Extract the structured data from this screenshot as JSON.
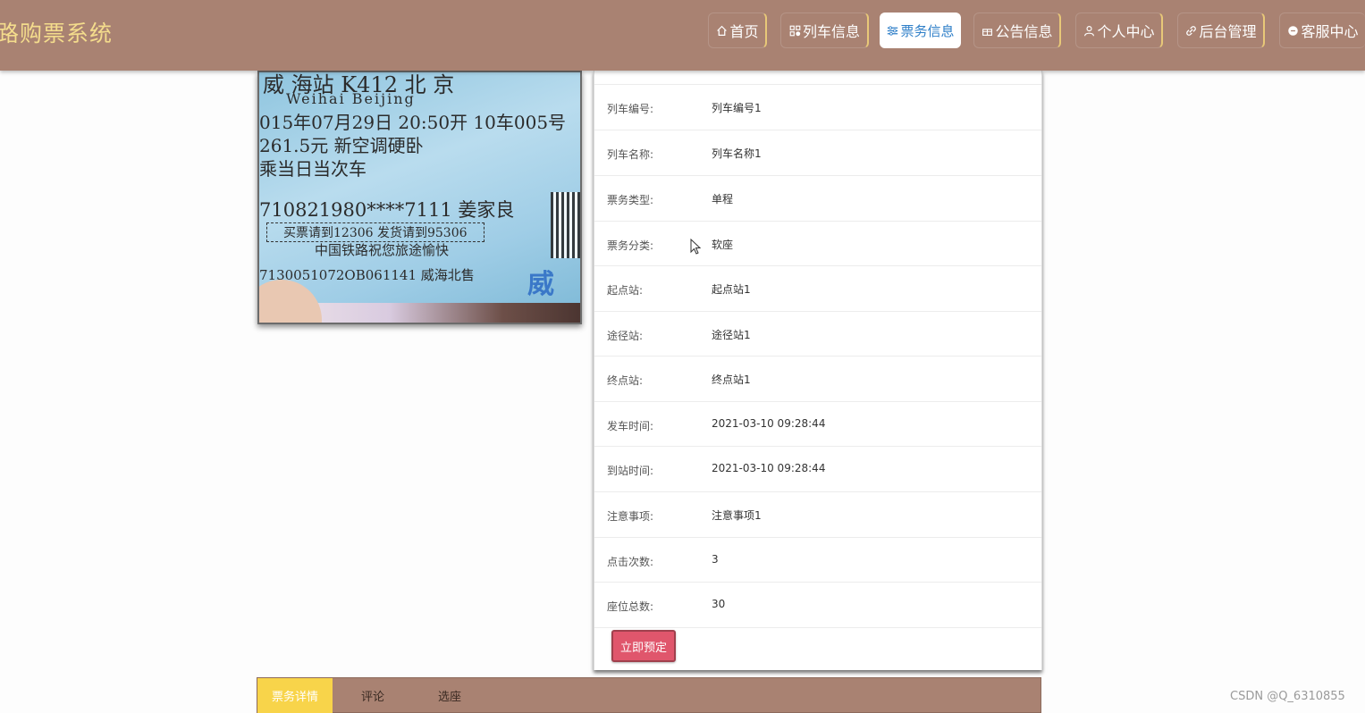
{
  "site": {
    "title": "铁路购票系统",
    "title_visible": "路购票系统"
  },
  "nav": {
    "items": [
      {
        "label": "首页",
        "icon": "home-icon"
      },
      {
        "label": "列车信息",
        "icon": "grid-icon"
      },
      {
        "label": "票务信息",
        "icon": "sliders-icon",
        "active": true
      },
      {
        "label": "公告信息",
        "icon": "gift-icon"
      },
      {
        "label": "个人中心",
        "icon": "user-icon"
      },
      {
        "label": "后台管理",
        "icon": "link-icon"
      },
      {
        "label": "客服中心",
        "icon": "chat-icon"
      }
    ]
  },
  "ticket_image": {
    "lines": [
      "威 海站  K412  北 京",
      "Weihai    Beijing",
      "015年07月29日 20:50开   10车005号",
      "261.5元   新空调硬卧",
      "乘当日当次车",
      "710821980****7111 姜家良",
      "买票请到12306 发货请到95306",
      "中国铁路祝您旅途愉快",
      "7130051072OB061141  威海北售",
      "威海"
    ]
  },
  "detail": {
    "rows": [
      {
        "label": "列车编号:",
        "value": "列车编号1"
      },
      {
        "label": "列车名称:",
        "value": "列车名称1"
      },
      {
        "label": "票务类型:",
        "value": "单程"
      },
      {
        "label": "票务分类:",
        "value": "软座"
      },
      {
        "label": "起点站:",
        "value": "起点站1"
      },
      {
        "label": "途径站:",
        "value": "途径站1"
      },
      {
        "label": "终点站:",
        "value": "终点站1"
      },
      {
        "label": "发车时间:",
        "value": "2021-03-10 09:28:44"
      },
      {
        "label": "到站时间:",
        "value": "2021-03-10 09:28:44"
      },
      {
        "label": "注意事项:",
        "value": "注意事项1"
      },
      {
        "label": "点击次数:",
        "value": "3"
      },
      {
        "label": "座位总数:",
        "value": "30"
      }
    ],
    "book_button": "立即预定"
  },
  "tabs": [
    {
      "label": "票务详情",
      "active": true
    },
    {
      "label": "评论"
    },
    {
      "label": "选座"
    }
  ],
  "watermark": "CSDN @Q_6310855",
  "colors": {
    "header": "#a98272",
    "title": "#f4dc8c",
    "active_tab": "#f8d44a",
    "book_button": "#e0566c",
    "active_nav_text": "#2f7fc8"
  }
}
